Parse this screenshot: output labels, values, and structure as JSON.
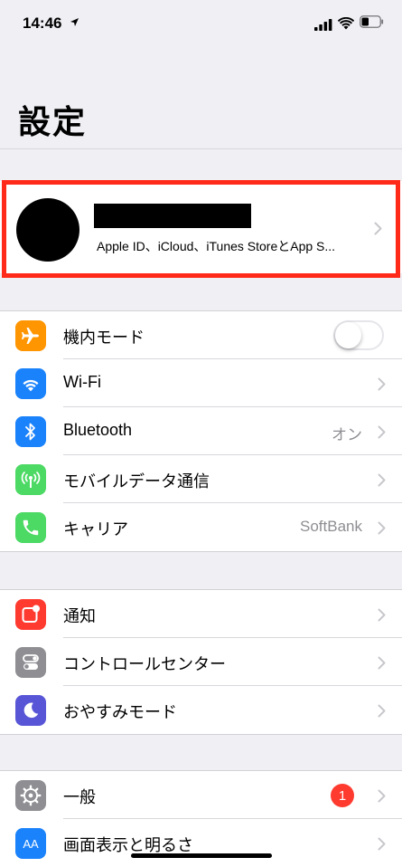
{
  "status_bar": {
    "time": "14:46"
  },
  "header": {
    "title": "設定"
  },
  "profile": {
    "subtitle": "Apple ID、iCloud、iTunes StoreとApp S..."
  },
  "group1": [
    {
      "label": "機内モード",
      "icon": "airplane-icon",
      "color": "#ff9500",
      "toggle": false
    },
    {
      "label": "Wi-Fi",
      "icon": "wifi-icon",
      "color": "#1a82fb"
    },
    {
      "label": "Bluetooth",
      "icon": "bluetooth-icon",
      "color": "#1a82fb",
      "value": "オン"
    },
    {
      "label": "モバイルデータ通信",
      "icon": "antenna-icon",
      "color": "#4cd964"
    },
    {
      "label": "キャリア",
      "icon": "phone-icon",
      "color": "#4cd964",
      "value": "SoftBank"
    }
  ],
  "group2": [
    {
      "label": "通知",
      "icon": "notification-icon",
      "color": "#ff3b30"
    },
    {
      "label": "コントロールセンター",
      "icon": "switches-icon",
      "color": "#8e8e93"
    },
    {
      "label": "おやすみモード",
      "icon": "moon-icon",
      "color": "#5856d6"
    }
  ],
  "group3": [
    {
      "label": "一般",
      "icon": "gear-icon",
      "color": "#8e8e93",
      "badge": "1"
    },
    {
      "label": "画面表示と明るさ",
      "icon": "display-icon",
      "color": "#1a82fb",
      "icon_text": "AA"
    }
  ]
}
